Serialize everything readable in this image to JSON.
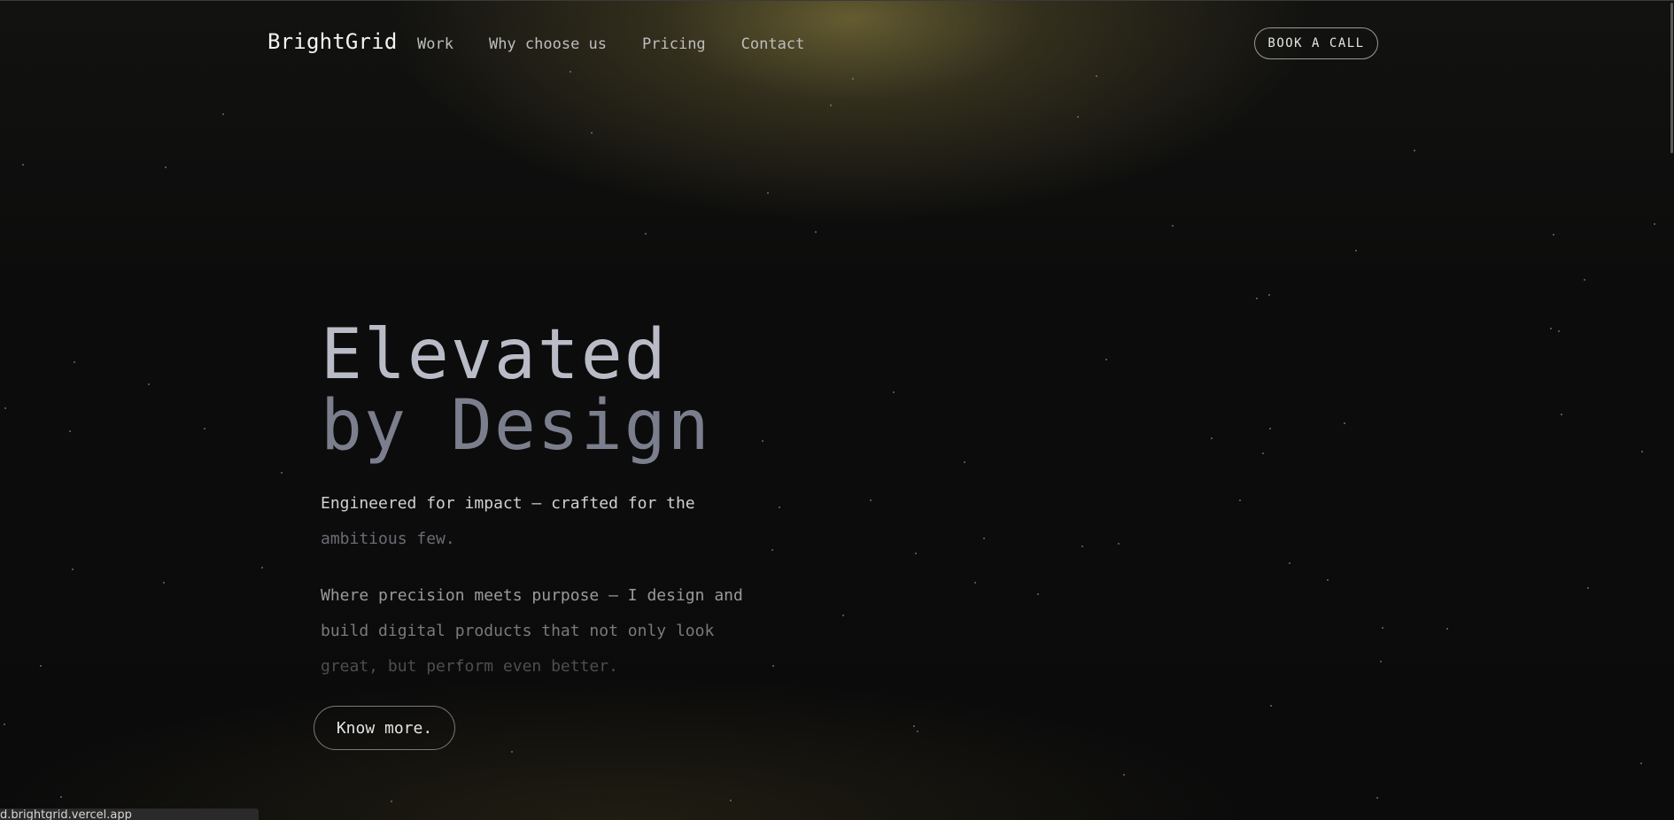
{
  "nav": {
    "brand": "BrightGrid",
    "links": [
      "Work",
      "Why choose us",
      "Pricing",
      "Contact"
    ],
    "cta": "BOOK A CALL"
  },
  "hero": {
    "title_line1": "Elevated",
    "title_line2": "by Design",
    "tagline_line1": "Engineered for impact — crafted for the",
    "tagline_line2": "ambitious few.",
    "desc_line1": "Where precision meets purpose — I design and",
    "desc_line2": "build digital products that not only look",
    "desc_line3": "great, but perform even better.",
    "button": "Know more."
  },
  "status_bar": {
    "url": "d.brightgrid.vercel.app"
  },
  "colors": {
    "background": "#0b0b0b",
    "glow": "#807440",
    "title_light": "#b9bcc6",
    "title_dim": "#7b7f8d"
  }
}
